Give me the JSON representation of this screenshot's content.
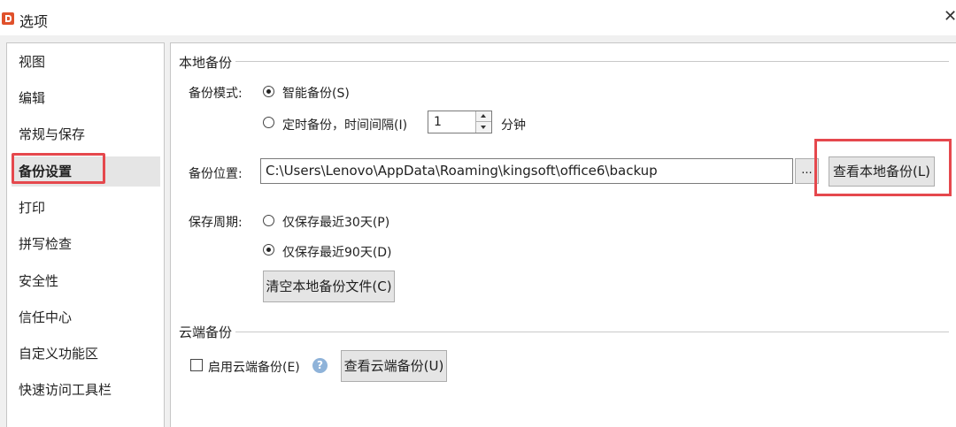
{
  "window": {
    "title": "选项",
    "close_glyph": "✕"
  },
  "sidebar": {
    "items": [
      {
        "label": "视图"
      },
      {
        "label": "编辑"
      },
      {
        "label": "常规与保存"
      },
      {
        "label": "备份设置",
        "active": true
      },
      {
        "label": "打印"
      },
      {
        "label": "拼写检查"
      },
      {
        "label": "安全性"
      },
      {
        "label": "信任中心"
      },
      {
        "label": "自定义功能区"
      },
      {
        "label": "快速访问工具栏"
      }
    ]
  },
  "local_backup": {
    "section_title": "本地备份",
    "mode_label": "备份模式:",
    "mode_smart": "智能备份(S)",
    "mode_timed": "定时备份，时间间隔(I)",
    "mode_selected": "smart",
    "interval_value": "1",
    "interval_unit": "分钟",
    "location_label": "备份位置:",
    "location_path": "C:\\Users\\Lenovo\\AppData\\Roaming\\kingsoft\\office6\\backup",
    "browse_label": "...",
    "view_local_button": "查看本地备份(L)",
    "period_label": "保存周期:",
    "period_30": "仅保存最近30天(P)",
    "period_90": "仅保存最近90天(D)",
    "period_selected": "90",
    "clear_button": "清空本地备份文件(C)"
  },
  "cloud_backup": {
    "section_title": "云端备份",
    "enable_label": "启用云端备份(E)",
    "enable_checked": false,
    "help_glyph": "?",
    "view_cloud_button": "查看云端备份(U)"
  },
  "colors": {
    "highlight_red": "#e5484d",
    "app_icon_orange": "#e0512b",
    "help_icon_blue": "#8fb3d9"
  }
}
